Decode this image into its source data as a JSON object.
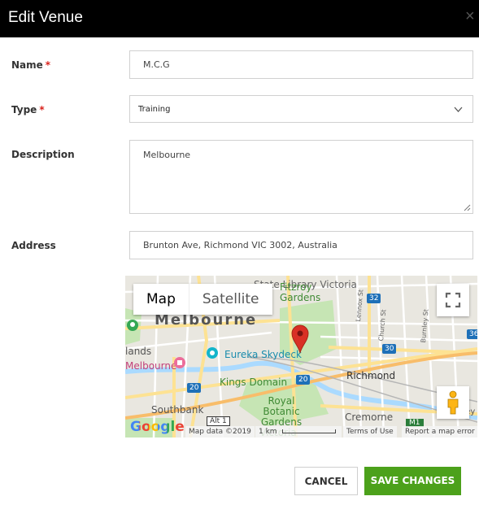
{
  "modal": {
    "title": "Edit Venue",
    "close_glyph": "×"
  },
  "form": {
    "name": {
      "label": "Name",
      "required_mark": "*",
      "value": "M.C.G"
    },
    "type": {
      "label": "Type",
      "required_mark": "*",
      "value": "Training"
    },
    "description": {
      "label": "Description",
      "value": "Melbourne"
    },
    "address": {
      "label": "Address",
      "value": "Brunton Ave, Richmond VIC 3002, Australia"
    }
  },
  "map": {
    "type_options": [
      "Map",
      "Satellite"
    ],
    "selected_type": "Map",
    "places": {
      "state_library": "State Library Victoria",
      "melbourne": "Melbourne",
      "fitzroy_gardens": "Fitzroy Gardens",
      "eureka": "Eureka Skydeck",
      "melbourne_pink": "Melbourne",
      "lands": "lands",
      "kings_domain": "Kings Domain",
      "richmond": "Richmond",
      "southbank": "Southbank",
      "botanic": "Royal Botanic Gardens Victoria -",
      "cremone": "Cremorne",
      "burnley": "Burnley",
      "lennox": "Lennox St",
      "church": "Church St",
      "burnley_st": "Burnley St"
    },
    "road_shields": [
      "32",
      "30",
      "36",
      "20",
      "20",
      "Alt 1",
      "M1"
    ],
    "google_logo": "Google",
    "attribution": "Map data ©2019",
    "scale": "1 km",
    "terms": "Terms of Use",
    "report": "Report a map error",
    "icons": [
      "fullscreen-icon",
      "pegman-icon",
      "location-pin-icon"
    ]
  },
  "actions": {
    "cancel": "CANCEL",
    "save": "SAVE CHANGES"
  },
  "colors": {
    "header_bg": "#000000",
    "save_bg": "#4ca11b",
    "required": "#d9221c",
    "pin": "#d93025"
  }
}
